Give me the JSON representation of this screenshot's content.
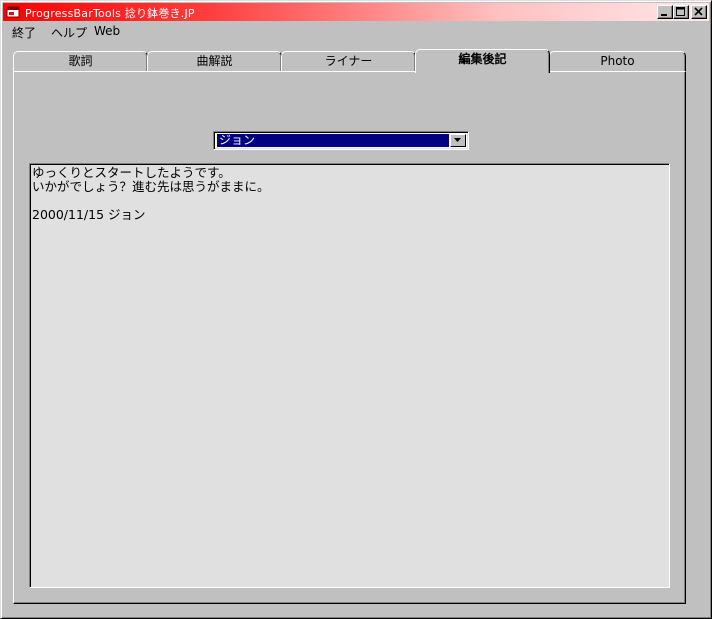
{
  "window": {
    "title": "ProgressBarTools  捻り鉢巻き.JP",
    "title_color_start": "#ff0000",
    "title_color_end": "#ffe8e8"
  },
  "titlebar_buttons": {
    "minimize": "minimize-icon",
    "maximize": "maximize-icon",
    "close": "close-icon"
  },
  "menu": {
    "items": [
      {
        "label": "終了"
      },
      {
        "label": "ヘルプ"
      },
      {
        "label": "Web"
      }
    ]
  },
  "tabs": [
    {
      "label": "歌詞",
      "active": false
    },
    {
      "label": "曲解説",
      "active": false
    },
    {
      "label": "ライナー",
      "active": false
    },
    {
      "label": "編集後記",
      "active": true
    },
    {
      "label": "Photo",
      "active": false
    }
  ],
  "author_select": {
    "value": "ジョン",
    "highlight_color": "#000080"
  },
  "notes": {
    "lines": [
      "ゆっくりとスタートしたようです。",
      "いかがでしょう？進む先は思うがままに。",
      "",
      "2000/11/15 ジョン"
    ]
  }
}
